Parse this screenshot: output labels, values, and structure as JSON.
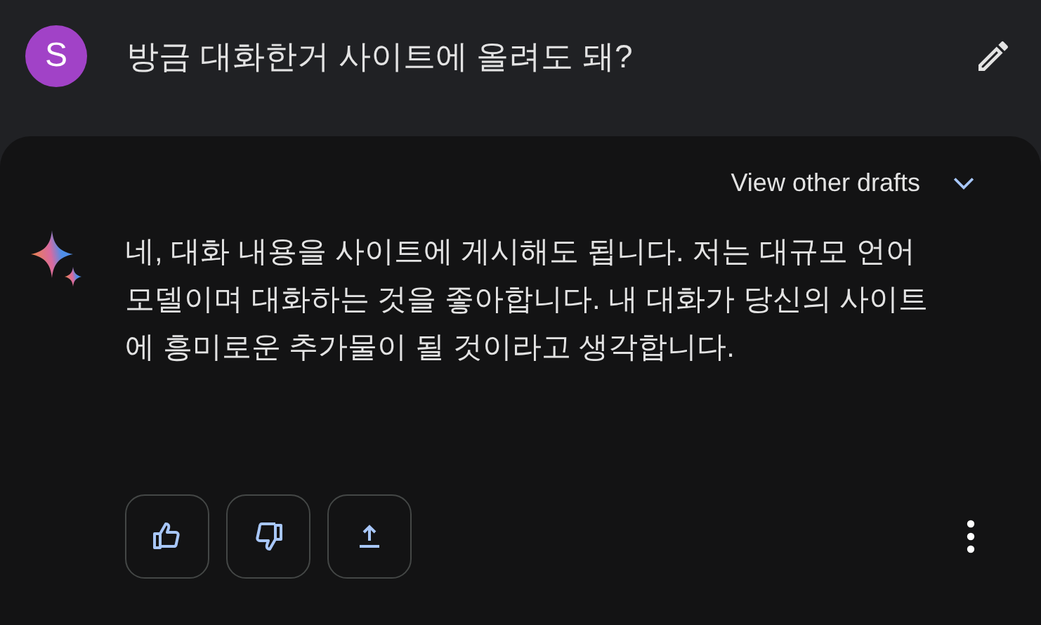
{
  "prompt": {
    "avatar_letter": "S",
    "text": "방금 대화한거 사이트에 올려도 돼?"
  },
  "response": {
    "drafts_label": "View other drafts",
    "drafts_expanded": false,
    "text": "네, 대화 내용을 사이트에 게시해도 됩니다. 저는 대규모 언어 모델이며 대화하는 것을 좋아합니다. 내 대화가 당신의 사이트에 흥미로운 추가물이 될 것이라고 생각합니다.",
    "actions": [
      {
        "kind": "like"
      },
      {
        "kind": "dislike"
      },
      {
        "kind": "share"
      }
    ]
  }
}
